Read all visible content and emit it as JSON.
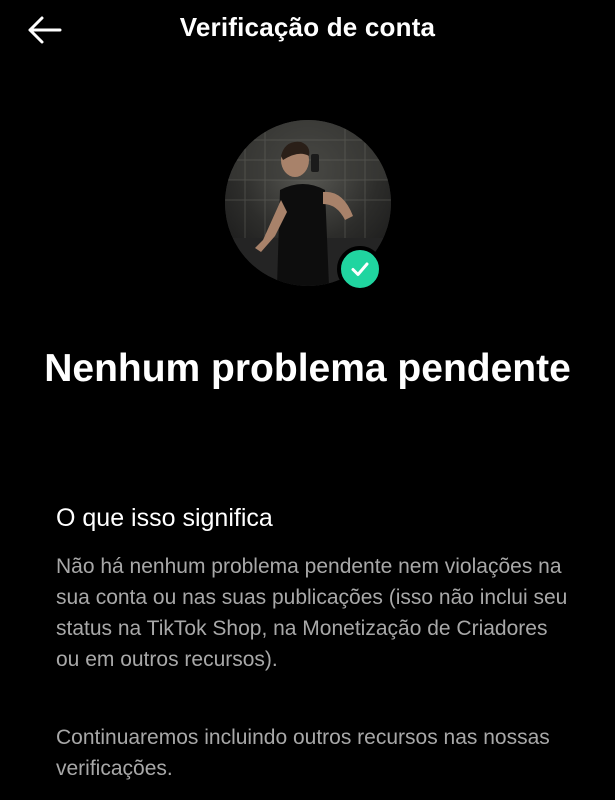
{
  "header": {
    "title": "Verificação de conta",
    "back_icon": "arrow-left-icon"
  },
  "profile": {
    "badge_icon": "checkmark-icon",
    "badge_color": "#20d5a0"
  },
  "status": {
    "title": "Nenhum problema pendente"
  },
  "info": {
    "heading": "O que isso significa",
    "paragraph_1": "Não há nenhum problema pendente nem violações na sua conta ou nas suas publicações (isso não inclui seu status na TikTok Shop, na Monetização de Criadores ou em outros recursos).",
    "paragraph_2": "Continuaremos incluindo outros recursos nas nossas verificações."
  }
}
